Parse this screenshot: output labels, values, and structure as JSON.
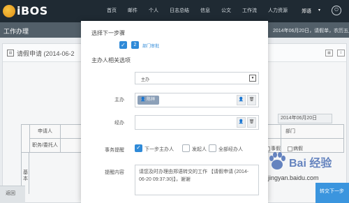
{
  "app": {
    "logo_text": "iBOS"
  },
  "nav": {
    "items": [
      "首页",
      "邮件",
      "个人",
      "日志总结",
      "信息",
      "公文",
      "工作流",
      "人力资源"
    ],
    "user": "郑语",
    "user_caret": "▾"
  },
  "page": {
    "title": "工作办理",
    "notice": "2014年06月20日，请假单，农历五月",
    "card_title": "请假申请 (2014-06-2",
    "date_value": "2014年06月20日",
    "bottom_left": "返回",
    "bottom_right": "转交下一步",
    "table": {
      "applicant": "申请人",
      "position": "职务/委托人",
      "dept": "部门",
      "vertical_label": "基本",
      "opt_leave": "事假",
      "opt_sick": "病假"
    }
  },
  "dialog": {
    "next_step_title": "选择下一步骤",
    "step_number": "2",
    "step_label": "部门审批",
    "handler_title": "主办人相关选项",
    "select_value": "主办",
    "main_label": "主办",
    "main_chip": "陈祥",
    "sign_label": "经办",
    "reminder_label": "事务提醒",
    "reminder_options": [
      {
        "label": "下一步主办人",
        "checked": true
      },
      {
        "label": "发起人",
        "checked": false
      },
      {
        "label": "全部经办人",
        "checked": false
      }
    ],
    "content_label": "提醒内容",
    "content_text": "请您及时办理由郑语转交的工作 【请假申请 (2014-06-20 09:37:30)】，谢谢"
  },
  "watermark": {
    "brand": "Bai 经验",
    "url": "jingyan.baidu.com"
  },
  "colors": {
    "accent": "#2f8ad8",
    "topbar": "#1f2a33",
    "chip": "#8ca0b8"
  }
}
